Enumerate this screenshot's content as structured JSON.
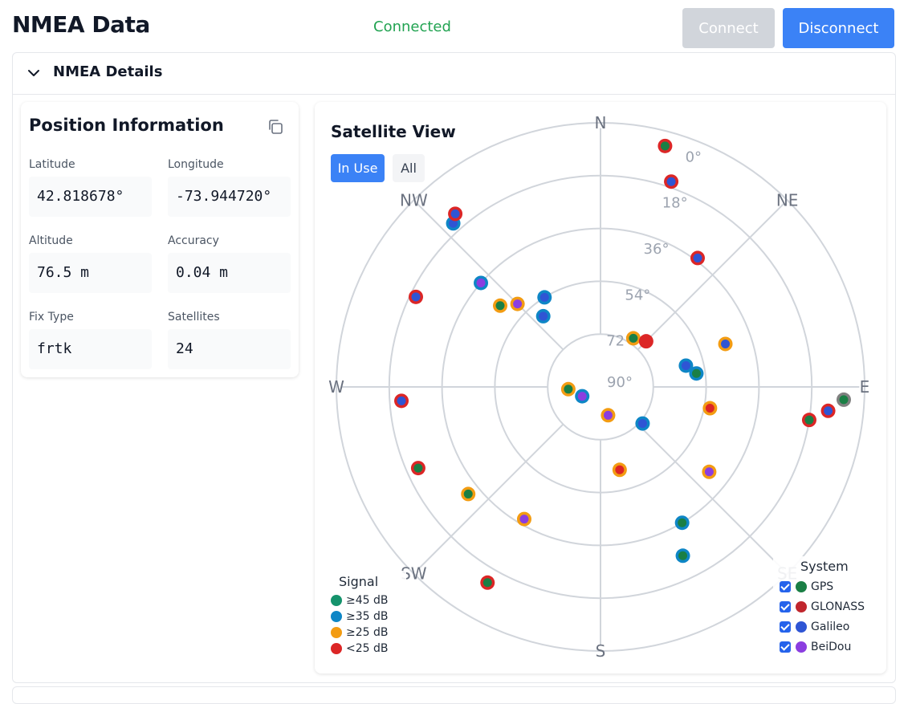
{
  "header": {
    "title": "NMEA Data",
    "status": "Connected",
    "connect_label": "Connect",
    "disconnect_label": "Disconnect"
  },
  "panel": {
    "title": "NMEA Details"
  },
  "position": {
    "title": "Position Information",
    "fields": [
      {
        "label": "Latitude",
        "value": "42.818678°"
      },
      {
        "label": "Longitude",
        "value": "-73.944720°"
      },
      {
        "label": "Altitude",
        "value": "76.5 m"
      },
      {
        "label": "Accuracy",
        "value": "0.04 m"
      },
      {
        "label": "Fix Type",
        "value": "frtk"
      },
      {
        "label": "Satellites",
        "value": "24"
      }
    ]
  },
  "satellite_view": {
    "title": "Satellite View",
    "tabs": [
      "In Use",
      "All"
    ],
    "active_tab": "In Use",
    "directions": [
      "N",
      "NE",
      "E",
      "SE",
      "S",
      "SW",
      "W",
      "NW"
    ],
    "elevation_labels": [
      "0°",
      "18°",
      "36°",
      "54°",
      "72°",
      "90°"
    ],
    "signal_legend": {
      "title": "Signal",
      "items": [
        {
          "label": "≥45 dB",
          "color": "#15936c"
        },
        {
          "label": "≥35 dB",
          "color": "#0e86c6"
        },
        {
          "label": "≥25 dB",
          "color": "#f39c12"
        },
        {
          "label": "<25 dB",
          "color": "#dc2626"
        }
      ]
    },
    "system_legend": {
      "title": "System",
      "items": [
        {
          "label": "GPS",
          "color": "#1a7f45",
          "checked": true
        },
        {
          "label": "GLONASS",
          "color": "#c0262d",
          "checked": true
        },
        {
          "label": "Galileo",
          "color": "#2f55d4",
          "checked": true
        },
        {
          "label": "BeiDou",
          "color": "#8b3ee0",
          "checked": true
        }
      ]
    },
    "satellites": [
      {
        "az": 15,
        "el": 5,
        "signal": "#dc2626",
        "system": "#1a7f45"
      },
      {
        "az": 19,
        "el": 16,
        "signal": "#dc2626",
        "system": "#2f55d4"
      },
      {
        "az": 318,
        "el": 15,
        "signal": "#0e86c6",
        "system": "#2f55d4"
      },
      {
        "az": 320,
        "el": 13,
        "signal": "#dc2626",
        "system": "#2f55d4"
      },
      {
        "az": 37,
        "el": 35,
        "signal": "#dc2626",
        "system": "#2f55d4"
      },
      {
        "az": 311,
        "el": 36,
        "signal": "#0e86c6",
        "system": "#8b3ee0"
      },
      {
        "az": 296,
        "el": 20,
        "signal": "#dc2626",
        "system": "#2f55d4"
      },
      {
        "az": 328,
        "el": 54,
        "signal": "#0e86c6",
        "system": "#2f55d4"
      },
      {
        "az": 309,
        "el": 46,
        "signal": "#f39c12",
        "system": "#1a7f45"
      },
      {
        "az": 315,
        "el": 50,
        "signal": "#f39c12",
        "system": "#8b3ee0"
      },
      {
        "az": 321,
        "el": 59,
        "signal": "#0e86c6",
        "system": "#2f55d4"
      },
      {
        "az": 34,
        "el": 70,
        "signal": "#f39c12",
        "system": "#1a7f45"
      },
      {
        "az": 45,
        "el": 68,
        "signal": "#dc2626",
        "system": "#dc2626"
      },
      {
        "az": 71,
        "el": 45,
        "signal": "#f39c12",
        "system": "#2f55d4"
      },
      {
        "az": 76,
        "el": 60,
        "signal": "#0e86c6",
        "system": "#2f55d4"
      },
      {
        "az": 82,
        "el": 57,
        "signal": "#0e86c6",
        "system": "#1a7f45"
      },
      {
        "az": 93,
        "el": 7,
        "signal": "#808080",
        "system": "#1a7f45"
      },
      {
        "az": 96,
        "el": 12,
        "signal": "#dc2626",
        "system": "#2f55d4"
      },
      {
        "az": 99,
        "el": 18,
        "signal": "#dc2626",
        "system": "#1a7f45"
      },
      {
        "az": 101,
        "el": 52,
        "signal": "#f39c12",
        "system": "#dc2626"
      },
      {
        "az": 243,
        "el": 83,
        "signal": "#0e86c6",
        "system": "#8b3ee0"
      },
      {
        "az": 266,
        "el": 79,
        "signal": "#f39c12",
        "system": "#1a7f45"
      },
      {
        "az": 266,
        "el": 22,
        "signal": "#dc2626",
        "system": "#2f55d4"
      },
      {
        "az": 246,
        "el": 22,
        "signal": "#dc2626",
        "system": "#1a7f45"
      },
      {
        "az": 131,
        "el": 71,
        "signal": "#0e86c6",
        "system": "#2f55d4"
      },
      {
        "az": 165,
        "el": 80,
        "signal": "#f39c12",
        "system": "#8b3ee0"
      },
      {
        "az": 128,
        "el": 43,
        "signal": "#f39c12",
        "system": "#8b3ee0"
      },
      {
        "az": 167,
        "el": 61,
        "signal": "#f39c12",
        "system": "#dc2626"
      },
      {
        "az": 149,
        "el": 36,
        "signal": "#0e86c6",
        "system": "#1a7f45"
      },
      {
        "az": 154,
        "el": 26,
        "signal": "#0e86c6",
        "system": "#1a7f45"
      },
      {
        "az": 231,
        "el": 32,
        "signal": "#f39c12",
        "system": "#1a7f45"
      },
      {
        "az": 210,
        "el": 38,
        "signal": "#f39c12",
        "system": "#8b3ee0"
      },
      {
        "az": 210,
        "el": 13,
        "signal": "#dc2626",
        "system": "#1a7f45"
      }
    ]
  }
}
